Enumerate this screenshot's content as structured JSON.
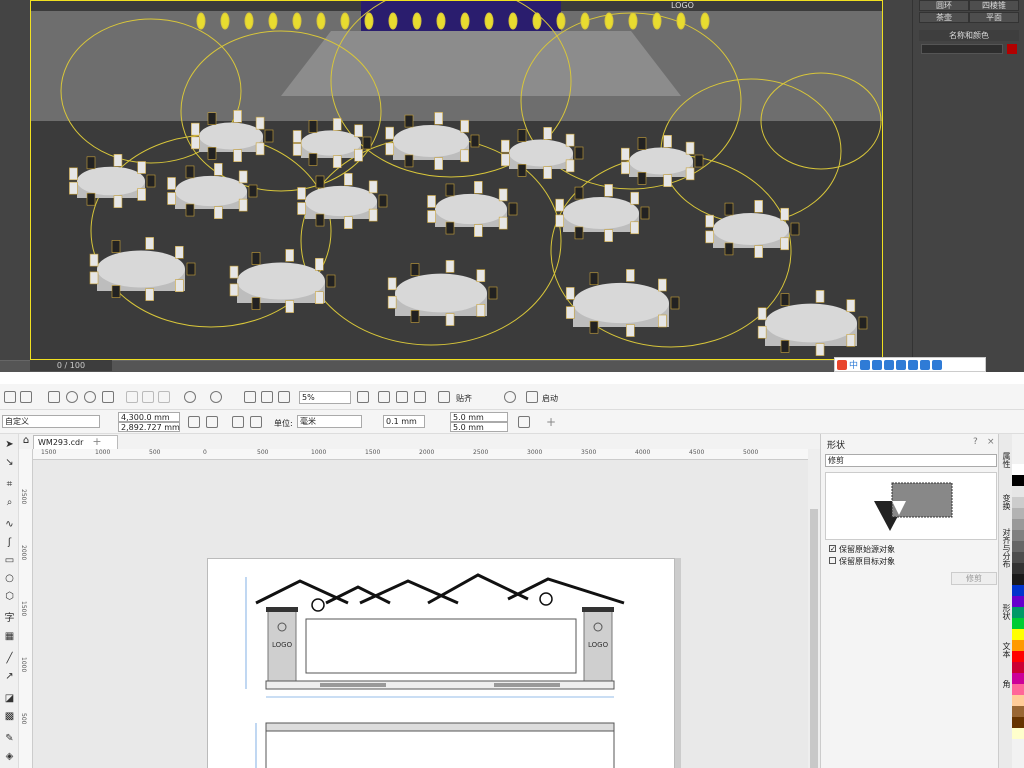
{
  "max": {
    "timeline_counter": "0 / 100",
    "banner_logo": "LOGO",
    "panel_buttons": [
      [
        "圆环",
        "四棱锥"
      ],
      [
        "茶壶",
        "平面"
      ]
    ],
    "name_color_label": "名称和颜色",
    "ime_label": "中"
  },
  "toolbar1": {
    "zoom_value": "5%",
    "snap_label": "贴齐",
    "launch_label": "启动"
  },
  "toolbar2": {
    "page_preset": "自定义",
    "width_value": "4,300.0 mm",
    "height_value": "2,892.727 mm",
    "units_label": "单位:",
    "units_value": "毫米",
    "nudge_value": "0.1 mm",
    "dup_x": "5.0 mm",
    "dup_y": "5.0 mm"
  },
  "document": {
    "tab_label": "WM293.cdr",
    "ruler_ticks": [
      "1500",
      "1000",
      "500",
      "0",
      "500",
      "1000",
      "1500",
      "2000",
      "2500",
      "3000",
      "3500",
      "4000",
      "4500",
      "5000"
    ],
    "ruler_v_ticks": [
      "2500",
      "2000",
      "1500",
      "1000",
      "500"
    ],
    "logo_left": "LOGO",
    "logo_right": "LOGO"
  },
  "docker": {
    "title": "形状",
    "mode_value": "修剪",
    "opt_keep_source": "保留原始源对象",
    "opt_keep_target": "保留原目标对象",
    "action_button": "修剪",
    "side_tabs": [
      "属性",
      "变换",
      "对齐与分布",
      "形状",
      "文本",
      "角"
    ]
  },
  "colors": {
    "viewport_border": "#f0e020",
    "accent": "#2f7bd6",
    "palette": [
      "#ffffff",
      "#000000",
      "#e6e6e6",
      "#cccccc",
      "#b3b3b3",
      "#999999",
      "#808080",
      "#666666",
      "#4d4d4d",
      "#333333",
      "#1a1a1a",
      "#0033cc",
      "#6600cc",
      "#009966",
      "#00cc33",
      "#ffff00",
      "#ff9900",
      "#ff0000",
      "#cc0033",
      "#cc0099",
      "#ff6699",
      "#ffcc99",
      "#996633",
      "#663300",
      "#ffffcc"
    ]
  }
}
